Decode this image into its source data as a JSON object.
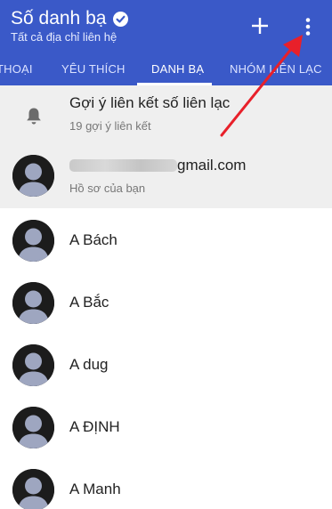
{
  "appbar": {
    "title": "Số danh bạ",
    "subtitle": "Tất cả địa chỉ liên hệ",
    "add_icon": "plus-icon",
    "more_icon": "more-vert-icon"
  },
  "tabs": [
    {
      "label": "THOẠI",
      "active": false
    },
    {
      "label": "YÊU THÍCH",
      "active": false
    },
    {
      "label": "DANH BẠ",
      "active": true
    },
    {
      "label": "NHÓM LIÊN LẠC",
      "active": false
    }
  ],
  "suggestions": {
    "title": "Gợi ý liên kết số liên lạc",
    "subtitle": "19 gợi ý liên kết",
    "icon": "bell-icon"
  },
  "profile": {
    "email_visible": "gmail.com",
    "subtitle": "Hồ sơ của bạn"
  },
  "contacts": [
    {
      "name": "A Bách"
    },
    {
      "name": "A Bắc"
    },
    {
      "name": "A dug"
    },
    {
      "name": "A ĐỊNH"
    },
    {
      "name": "A Manh"
    }
  ],
  "colors": {
    "appbar": "#3a59c8",
    "annotation_arrow": "#e8202a"
  }
}
